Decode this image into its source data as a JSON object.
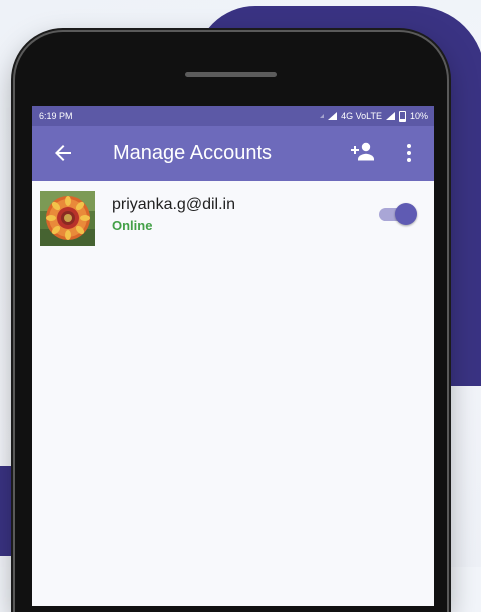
{
  "status_bar": {
    "time": "6:19 PM",
    "network": "4G VoLTE",
    "battery": "10%"
  },
  "app_bar": {
    "title": "Manage Accounts",
    "back_icon": "arrow-left-icon",
    "add_icon": "add-user-icon",
    "menu_icon": "more-vert-icon"
  },
  "accounts": [
    {
      "email": "priyanka.g@dil.in",
      "status": "Online",
      "enabled": true
    }
  ],
  "colors": {
    "app_bar": "#6d6abb",
    "status_bar": "#5c59a6",
    "accent": "#5f5bb3",
    "online": "#43a047",
    "background_blob": "#3a3383"
  }
}
